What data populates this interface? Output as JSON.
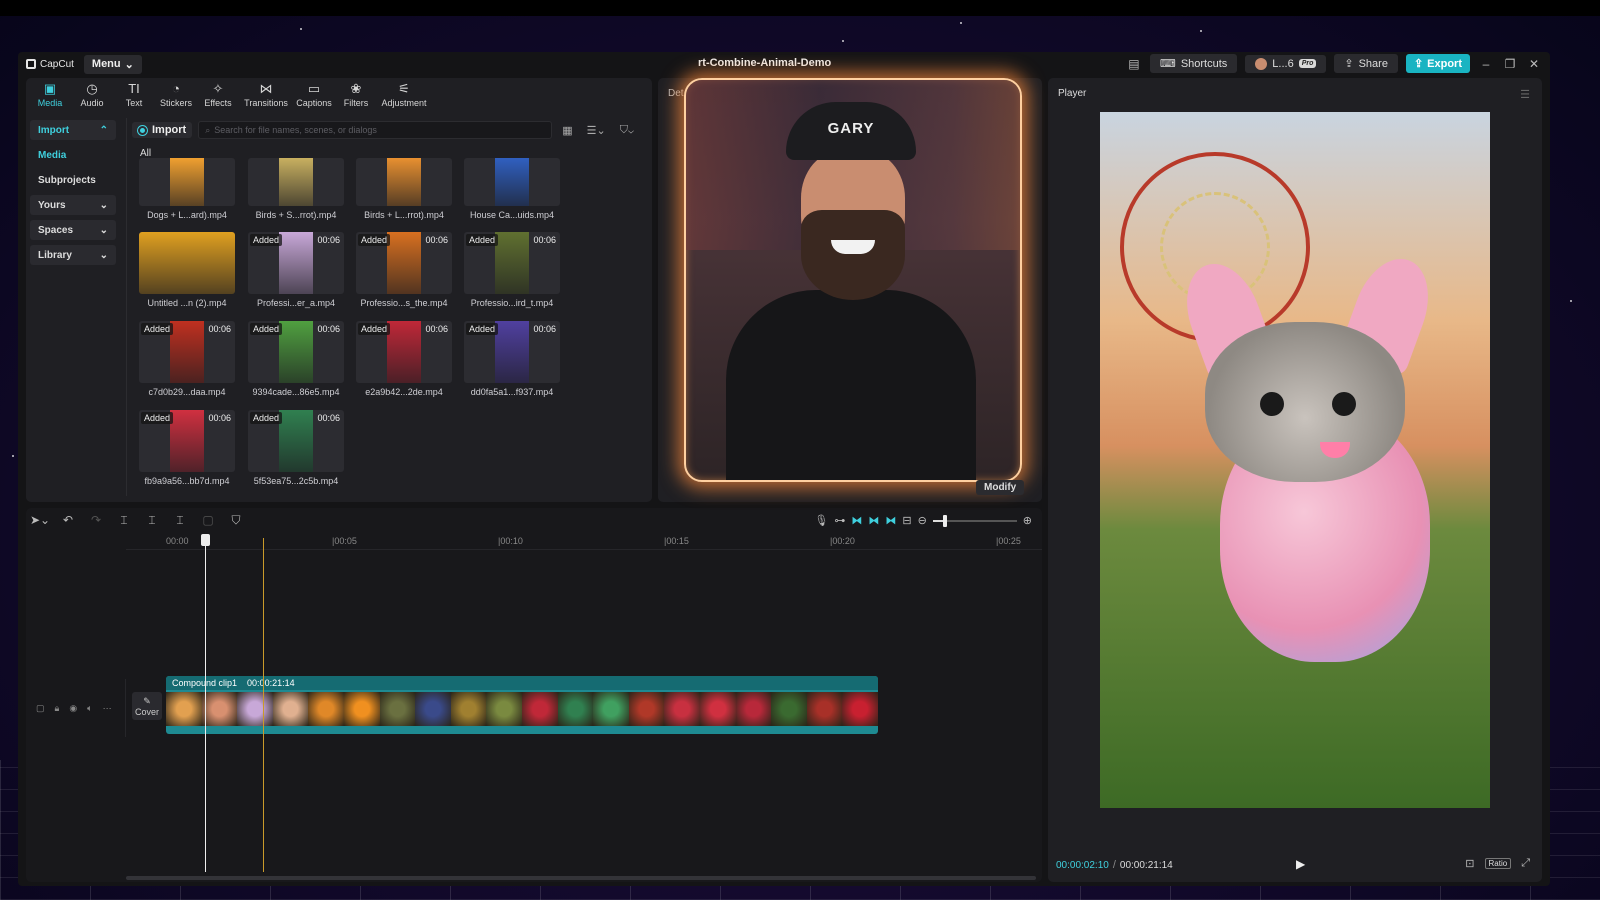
{
  "colors": {
    "accent": "#3fd0de",
    "glow": "#ff8c3c",
    "bg": "#141416"
  },
  "app": {
    "logo": "CapCut",
    "menu": "Menu",
    "title": "rt-Combine-Animal-Demo"
  },
  "titlebar": {
    "shortcuts": "Shortcuts",
    "user": "L...6",
    "pro": "Pro",
    "share": "Share",
    "export": "Export"
  },
  "toolbar": [
    {
      "label": "Media",
      "icon": "media-icon"
    },
    {
      "label": "Audio",
      "icon": "audio-icon"
    },
    {
      "label": "Text",
      "icon": "text-icon"
    },
    {
      "label": "Stickers",
      "icon": "stickers-icon"
    },
    {
      "label": "Effects",
      "icon": "effects-icon"
    },
    {
      "label": "Transitions",
      "icon": "transitions-icon"
    },
    {
      "label": "Captions",
      "icon": "captions-icon"
    },
    {
      "label": "Filters",
      "icon": "filters-icon"
    },
    {
      "label": "Adjustment",
      "icon": "adjustment-icon"
    }
  ],
  "sidebar": {
    "items": [
      {
        "label": "Import"
      },
      {
        "label": "Media"
      },
      {
        "label": "Subprojects"
      },
      {
        "label": "Yours"
      },
      {
        "label": "Spaces"
      },
      {
        "label": "Library"
      }
    ]
  },
  "media": {
    "import_label": "Import",
    "search_placeholder": "Search for file names, scenes, or dialogs",
    "filter_all": "All",
    "added": "Added",
    "items": [
      {
        "name": "Dogs + L...ard).mp4",
        "added": false,
        "duration": "",
        "color": "#f0a030"
      },
      {
        "name": "Birds + S...rrot).mp4",
        "added": false,
        "duration": "",
        "color": "#c8b060"
      },
      {
        "name": "Birds + L...rrot).mp4",
        "added": false,
        "duration": "",
        "color": "#e89030"
      },
      {
        "name": "House Ca...uids.mp4",
        "added": false,
        "duration": "",
        "color": "#3060c0"
      },
      {
        "name": "Untitled ...n (2).mp4",
        "added": false,
        "duration": "",
        "color": "#e0a020"
      },
      {
        "name": "Professi...er_a.mp4",
        "added": true,
        "duration": "00:06",
        "color": "#c8a8d8"
      },
      {
        "name": "Professio...s_the.mp4",
        "added": true,
        "duration": "00:06",
        "color": "#d87020"
      },
      {
        "name": "Professio...ird_t.mp4",
        "added": true,
        "duration": "00:06",
        "color": "#607030"
      },
      {
        "name": "c7d0b29...daa.mp4",
        "added": true,
        "duration": "00:06",
        "color": "#c03020"
      },
      {
        "name": "9394cade...86e5.mp4",
        "added": true,
        "duration": "00:06",
        "color": "#50a040"
      },
      {
        "name": "e2a9b42...2de.mp4",
        "added": true,
        "duration": "00:06",
        "color": "#c02838"
      },
      {
        "name": "dd0fa5a1...f937.mp4",
        "added": true,
        "duration": "00:06",
        "color": "#5040a0"
      },
      {
        "name": "fb9a9a56...bb7d.mp4",
        "added": true,
        "duration": "00:06",
        "color": "#d03040"
      },
      {
        "name": "5f53ea75...2c5b.mp4",
        "added": true,
        "duration": "00:06",
        "color": "#308050"
      }
    ]
  },
  "details": {
    "tab": "Det",
    "cap_text": "GARY",
    "modify": "Modify"
  },
  "player": {
    "title": "Player",
    "current_time": "00:00:02:10",
    "total_time": "00:00:21:14",
    "ratio": "Ratio"
  },
  "timeline": {
    "ticks": [
      "00:00",
      "|00:05",
      "|00:10",
      "|00:15",
      "|00:20",
      "|00:25"
    ],
    "cover": "Cover",
    "clip_name": "Compound clip1",
    "clip_duration": "00:00:21:14",
    "clip_frames": [
      "#e2a050",
      "#d89070",
      "#c8a8d8",
      "#e0b090",
      "#e08828",
      "#f09020",
      "#6a7040",
      "#3a4a8a",
      "#a08030",
      "#7a8a40",
      "#c02838",
      "#308050",
      "#40a060",
      "#b03828",
      "#c83040",
      "#d03040",
      "#b8283a",
      "#3a6a30",
      "#a83028",
      "#c82030"
    ]
  }
}
